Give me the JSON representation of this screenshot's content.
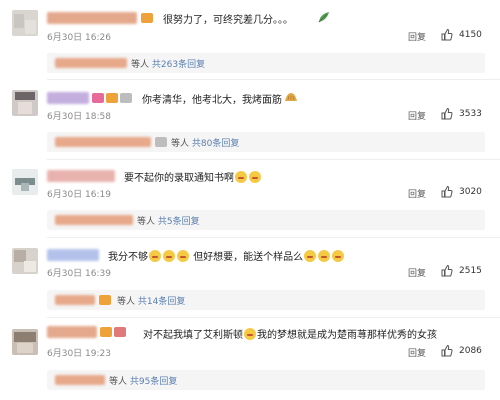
{
  "comments": [
    {
      "text": "很努力了，可终究差几分。。。",
      "date": "6月30日 16:26",
      "reply_label": "回复",
      "likes": "4150",
      "sub": {
        "suffix": "等人",
        "link": "共263条回复"
      }
    },
    {
      "text": "你考清华，他考北大，我烤面筋",
      "date": "6月30日 18:58",
      "reply_label": "回复",
      "likes": "3533",
      "sub": {
        "suffix": "等人",
        "link": "共80条回复"
      }
    },
    {
      "text": "要不起你的录取通知书啊",
      "date": "6月30日 16:19",
      "reply_label": "回复",
      "likes": "3020",
      "sub": {
        "suffix": "等人",
        "link": "共5条回复"
      }
    },
    {
      "text_a": "我分不够",
      "text_b": "但好想要，能送个样品么",
      "date": "6月30日 16:39",
      "reply_label": "回复",
      "likes": "2515",
      "sub": {
        "suffix": "等人",
        "link": "共14条回复"
      }
    },
    {
      "text_a": "对不起我填了艾利斯顿",
      "text_b": "我的梦想就是成为楚雨荨那样优秀的女孩",
      "date": "6月30日 19:23",
      "reply_label": "回复",
      "likes": "2086",
      "sub": {
        "suffix": "等人",
        "link": "共95条回复"
      }
    }
  ],
  "icons": {
    "like": "thumbs-up-icon",
    "emoji": "grinning-face-icon"
  },
  "colors": {
    "link": "#5a7fb0",
    "sub_bg": "#f5f5f5"
  }
}
